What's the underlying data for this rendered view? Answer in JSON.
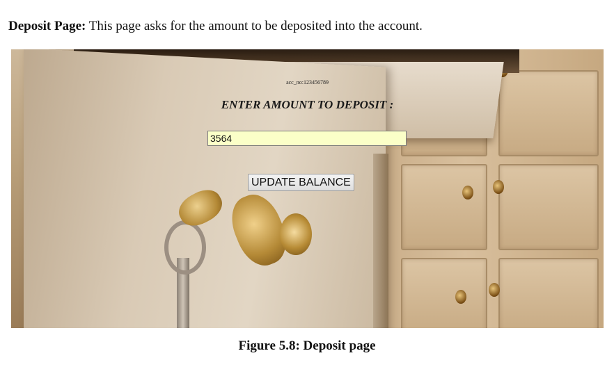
{
  "caption_top": {
    "label": "Deposit Page:",
    "text": " This page asks for the amount to be deposited into the account."
  },
  "form": {
    "account_text": "acc_no:123456789",
    "heading": "ENTER AMOUNT TO DEPOSIT :",
    "amount_value": "3564",
    "update_button_label": "UPDATE BALANCE"
  },
  "caption_bottom": "Figure 5.8: Deposit page"
}
